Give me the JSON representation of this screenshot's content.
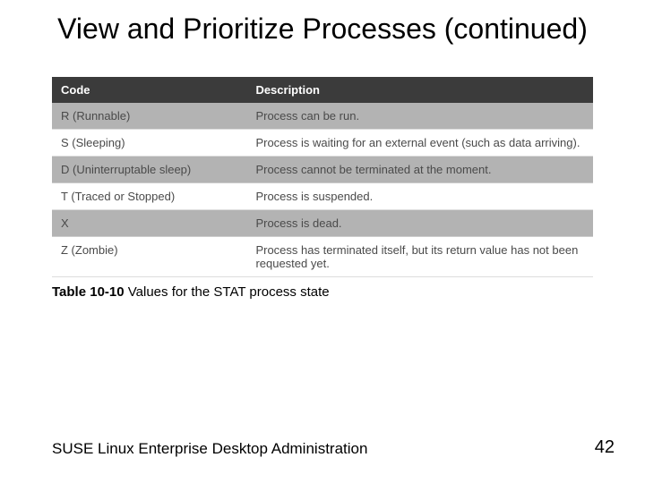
{
  "slide": {
    "title": "View and Prioritize Processes (continued)",
    "caption_bold": "Table 10-10",
    "caption_rest": " Values for the STAT process state",
    "footer": "SUSE Linux Enterprise Desktop Administration",
    "page": "42"
  },
  "table": {
    "headers": {
      "code": "Code",
      "desc": "Description"
    },
    "rows": [
      {
        "code": "R (Runnable)",
        "desc": "Process can be run."
      },
      {
        "code": "S (Sleeping)",
        "desc": "Process is waiting for an external event (such as data arriving)."
      },
      {
        "code": "D (Uninterruptable sleep)",
        "desc": "Process cannot be terminated at the moment."
      },
      {
        "code": "T (Traced or Stopped)",
        "desc": "Process is suspended."
      },
      {
        "code": "X",
        "desc": "Process is dead."
      },
      {
        "code": "Z (Zombie)",
        "desc": "Process has terminated itself, but its return value has not been requested yet."
      }
    ]
  },
  "chart_data": {
    "type": "table",
    "title": "Table 10-10 Values for the STAT process state",
    "columns": [
      "Code",
      "Description"
    ],
    "rows": [
      [
        "R (Runnable)",
        "Process can be run."
      ],
      [
        "S (Sleeping)",
        "Process is waiting for an external event (such as data arriving)."
      ],
      [
        "D (Uninterruptable sleep)",
        "Process cannot be terminated at the moment."
      ],
      [
        "T (Traced or Stopped)",
        "Process is suspended."
      ],
      [
        "X",
        "Process is dead."
      ],
      [
        "Z (Zombie)",
        "Process has terminated itself, but its return value has not been requested yet."
      ]
    ]
  }
}
